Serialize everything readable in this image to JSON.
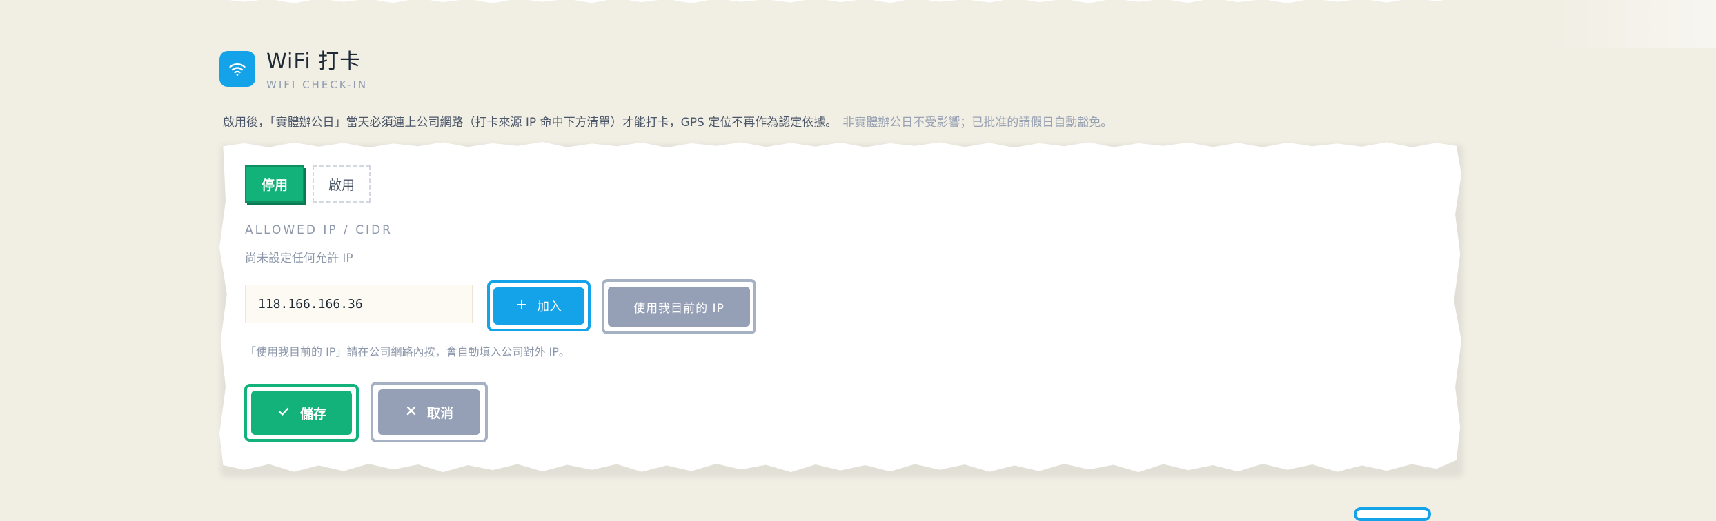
{
  "section": {
    "title": "WiFi 打卡",
    "subtitle": "WIFI CHECK-IN",
    "description": "啟用後，「實體辦公日」當天必須連上公司網路（打卡來源 IP 命中下方清單）才能打卡，GPS 定位不再作為認定依據。",
    "description_note": "非實體辦公日不受影響；已批准的請假日自動豁免。"
  },
  "toggle": {
    "off_label": "停用",
    "on_label": "啟用",
    "selected": "停用"
  },
  "allowed_ip": {
    "label": "ALLOWED IP / CIDR",
    "empty_text": "尚未設定任何允許 IP",
    "input_value": "118.166.166.36",
    "add_label": "加入",
    "use_my_ip_label": "使用我目前的 IP",
    "hint": "「使用我目前的 IP」請在公司網路內按，會自動填入公司對外 IP。"
  },
  "actions": {
    "save_label": "儲存",
    "cancel_label": "取消"
  },
  "colors": {
    "accent_green": "#12b27a",
    "accent_blue": "#14a3e8",
    "muted_gray": "#959fb5",
    "background": "#f1eee4"
  },
  "icons": {
    "header": "wifi-icon",
    "add": "plus-icon",
    "save": "check-icon",
    "cancel": "close-icon"
  }
}
